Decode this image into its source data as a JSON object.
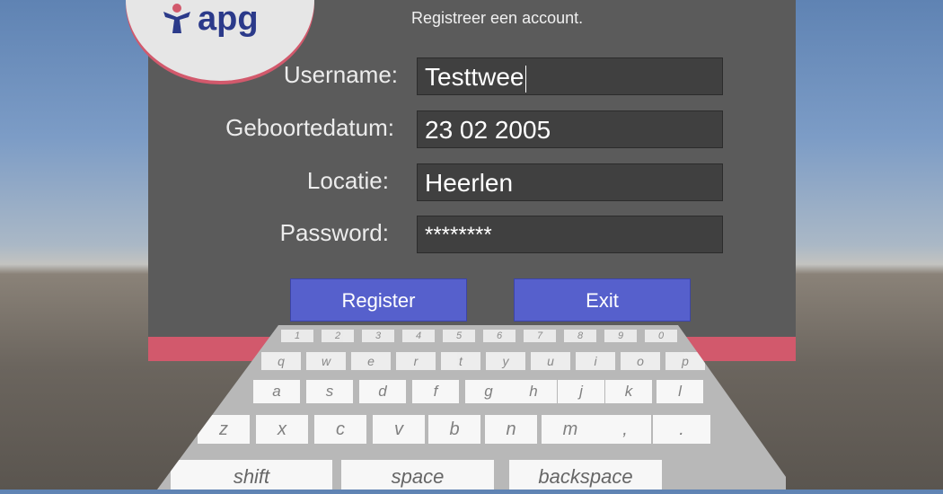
{
  "logo": {
    "text": "apg"
  },
  "form": {
    "subtitle": "Registreer een account.",
    "username_label": "Username:",
    "username_value": "Testtwee",
    "birthdate_label": "Geboortedatum:",
    "birthdate_value": "23 02 2005",
    "location_label": "Locatie:",
    "location_value": "Heerlen",
    "password_label": "Password:",
    "password_value": "********"
  },
  "buttons": {
    "register": "Register",
    "exit": "Exit"
  },
  "keyboard": {
    "row1": [
      "1",
      "2",
      "3",
      "4",
      "5",
      "6",
      "7",
      "8",
      "9",
      "0"
    ],
    "row2": [
      "q",
      "w",
      "e",
      "r",
      "t",
      "y",
      "u",
      "i",
      "o",
      "p"
    ],
    "row3": [
      "a",
      "s",
      "d",
      "f",
      "g",
      "h",
      "j",
      "k",
      "l"
    ],
    "row4": [
      "z",
      "x",
      "c",
      "v",
      "b",
      "n",
      "m",
      ",",
      "."
    ],
    "row5": [
      "shift",
      "space",
      "backspace"
    ]
  },
  "colors": {
    "panel": "#5b5b5b",
    "accent": "#d2596c",
    "button": "#5660cc",
    "brand": "#2b3a8a"
  }
}
